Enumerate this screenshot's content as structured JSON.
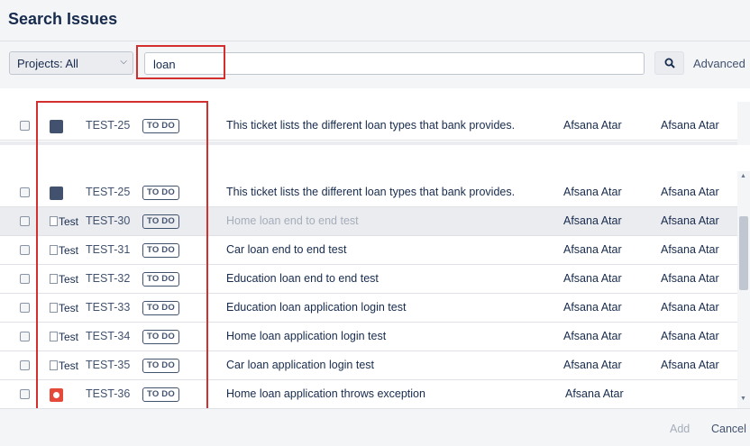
{
  "dialog": {
    "title": "Search Issues"
  },
  "toolbar": {
    "projects_label": "Projects: All",
    "search_value": "loan",
    "advanced_label": "Advanced"
  },
  "pinned_row": {
    "key": "TEST-25",
    "status": "TO DO",
    "summary": "This ticket lists the different loan types that bank provides.",
    "assignee": "Afsana Atar",
    "reporter": "Afsana Atar",
    "icon": "bolt-icon"
  },
  "rows": [
    {
      "key": "TEST-25",
      "status": "TO DO",
      "summary": "This ticket lists the different loan types that bank provides.",
      "assignee": "Afsana Atar",
      "reporter": "Afsana Atar",
      "icon": "bolt-icon",
      "icon_alt": ""
    },
    {
      "key": "TEST-30",
      "status": "TO DO",
      "summary": "Home loan end to end test",
      "assignee": "Afsana Atar",
      "reporter": "Afsana Atar",
      "icon": "broken-image-icon",
      "icon_alt": "Test"
    },
    {
      "key": "TEST-31",
      "status": "TO DO",
      "summary": "Car loan end to end test",
      "assignee": "Afsana Atar",
      "reporter": "Afsana Atar",
      "icon": "broken-image-icon",
      "icon_alt": "Test"
    },
    {
      "key": "TEST-32",
      "status": "TO DO",
      "summary": "Education loan end to end test",
      "assignee": "Afsana Atar",
      "reporter": "Afsana Atar",
      "icon": "broken-image-icon",
      "icon_alt": "Test"
    },
    {
      "key": "TEST-33",
      "status": "TO DO",
      "summary": "Education loan application login test",
      "assignee": "Afsana Atar",
      "reporter": "Afsana Atar",
      "icon": "broken-image-icon",
      "icon_alt": "Test"
    },
    {
      "key": "TEST-34",
      "status": "TO DO",
      "summary": "Home loan application login test",
      "assignee": "Afsana Atar",
      "reporter": "Afsana Atar",
      "icon": "broken-image-icon",
      "icon_alt": "Test"
    },
    {
      "key": "TEST-35",
      "status": "TO DO",
      "summary": "Car loan application login test",
      "assignee": "Afsana Atar",
      "reporter": "Afsana Atar",
      "icon": "broken-image-icon",
      "icon_alt": "Test"
    },
    {
      "key": "TEST-36",
      "status": "TO DO",
      "summary": "Home loan application throws exception",
      "assignee": "Afsana Atar",
      "reporter": "",
      "icon": "bug-icon",
      "icon_alt": ""
    }
  ],
  "footer": {
    "add_label": "Add",
    "cancel_label": "Cancel"
  },
  "colors": {
    "highlight": "#d32f2f",
    "bug": "#e5493a",
    "bolt": "#42526e"
  }
}
